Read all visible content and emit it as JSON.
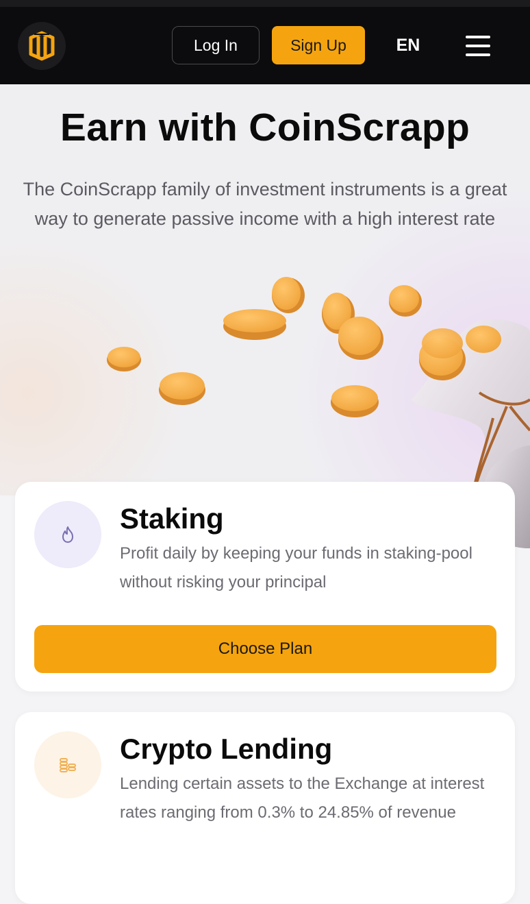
{
  "header": {
    "logo_icon": "coinscrapp-logo-icon",
    "login_label": "Log In",
    "signup_label": "Sign Up",
    "language": "EN",
    "menu_icon": "hamburger-menu-icon"
  },
  "hero": {
    "title": "Earn with CoinScrapp",
    "subtitle": "The CoinScrapp family of investment instruments is a great way to generate passive income with a high interest rate",
    "illustration": "coins-and-money-bag-illustration"
  },
  "products": [
    {
      "title": "Staking",
      "description": "Profit daily by keeping your funds in staking-pool without risking your principal",
      "icon": "flame-icon",
      "button_label": "Choose Plan"
    },
    {
      "title": "Crypto Lending",
      "description": "Lending certain assets to the Exchange at interest rates ranging from 0.3% to 24.85% of revenue",
      "icon": "coin-stack-icon"
    }
  ],
  "colors": {
    "accent": "#f5a40f",
    "header_bg": "#0c0c0e",
    "staking_icon_bg": "#eeebfa",
    "lending_icon_bg": "#fdf3e6"
  }
}
